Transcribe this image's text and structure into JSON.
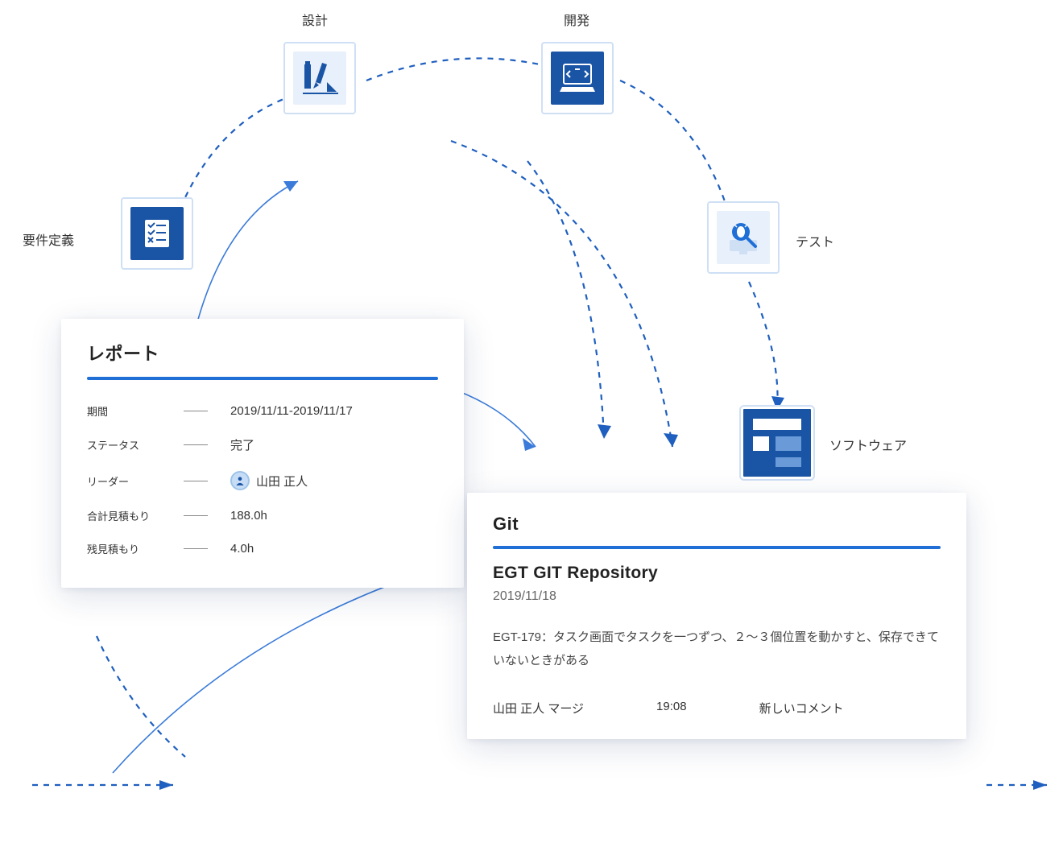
{
  "stages": {
    "requirements": "要件定義",
    "design": "設計",
    "development": "開発",
    "test": "テスト",
    "software": "ソフトウェア"
  },
  "report": {
    "title": "レポート",
    "rows": {
      "period": {
        "label": "期間",
        "value": "2019/11/11-2019/11/17"
      },
      "status": {
        "label": "ステータス",
        "value": "完了"
      },
      "leader": {
        "label": "リーダー",
        "value": "山田 正人"
      },
      "estimate_total": {
        "label": "合計見積もり",
        "value": "188.0h"
      },
      "estimate_remaining": {
        "label": "残見積もり",
        "value": "4.0h"
      }
    }
  },
  "git": {
    "title": "Git",
    "repo": "EGT GIT Repository",
    "date": "2019/11/18",
    "body": "EGT-179：タスク画面でタスクを一つずつ、２〜３個位置を動かすと、保存できていないときがある",
    "footer": {
      "author_action": "山田 正人 マージ",
      "time": "19:08",
      "comment_label": "新しいコメント"
    }
  }
}
